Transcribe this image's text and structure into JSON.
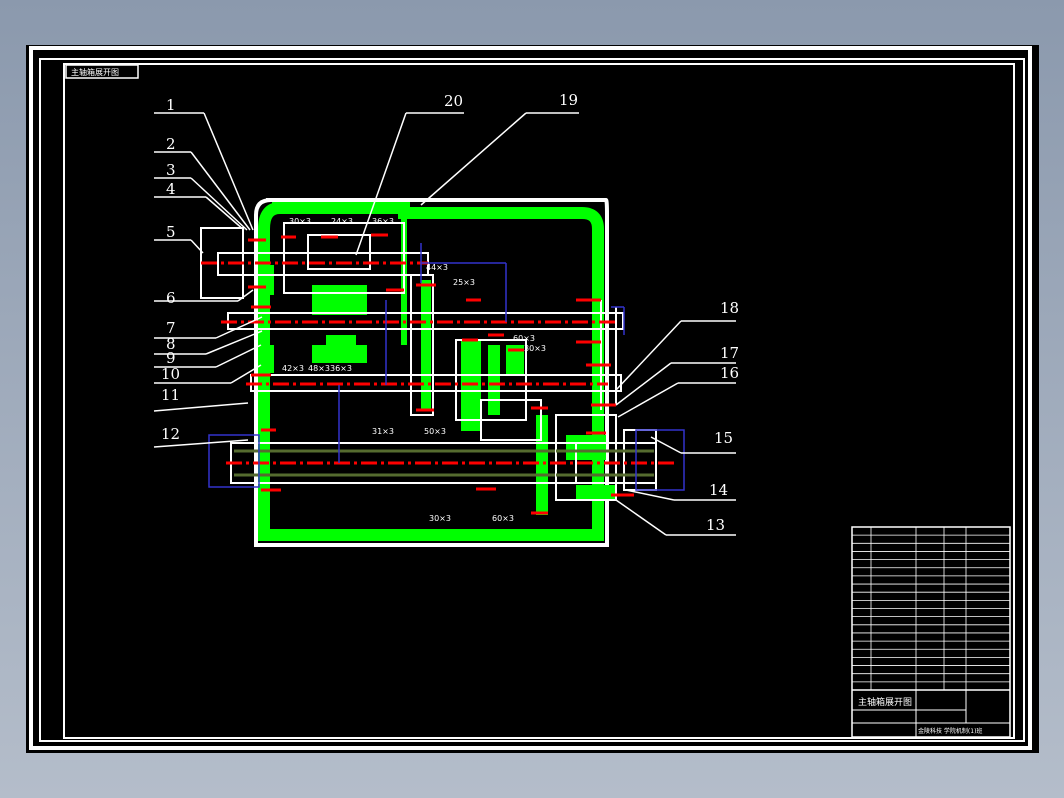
{
  "drawing": {
    "title_tag": "主轴箱展开图",
    "colors": {
      "background": "#000000",
      "housing": "#00ff00",
      "shaft_centerline": "#ff0000",
      "dimension": "#3333cc",
      "spline": "#556b2f",
      "outline": "#ffffff"
    }
  },
  "callouts": [
    "1",
    "2",
    "3",
    "4",
    "5",
    "6",
    "7",
    "8",
    "9",
    "10",
    "11",
    "12",
    "13",
    "14",
    "15",
    "16",
    "17",
    "18",
    "19",
    "20"
  ],
  "gear_labels": {
    "g30x3_top": "30×3",
    "g24x3": "24×3",
    "g36x3": "36×3",
    "g44x3": "44×3",
    "g25x3": "25×3",
    "g60x3_mid": "60×3",
    "g30x3_mid": "30×3",
    "g42x3": "42×3",
    "g48x3": "48×3",
    "g36x3_low": "36×3",
    "g31x3": "31×3",
    "g50x3": "50×3",
    "g30x3_bot": "30×3",
    "g60x3_bot": "60×3"
  },
  "title_block": {
    "part_name": "主轴箱展开图",
    "school_line": "金陵科技 学院机制(1)班"
  }
}
